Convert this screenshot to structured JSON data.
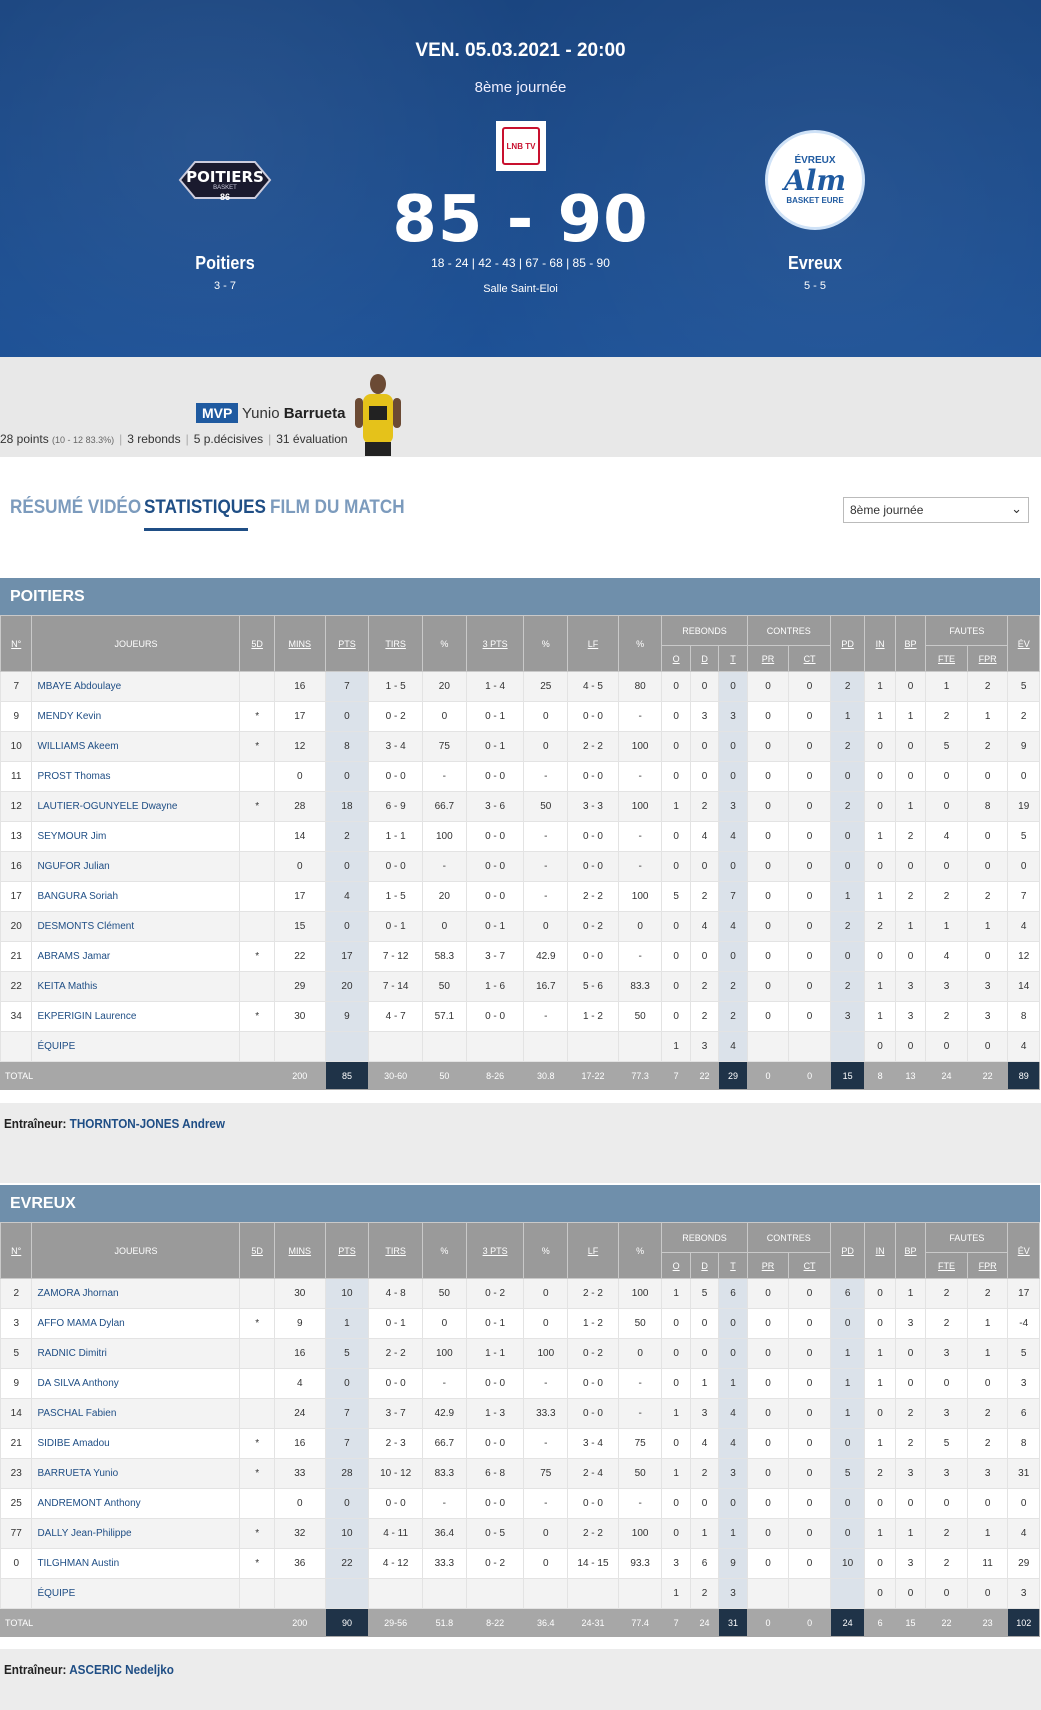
{
  "match": {
    "date": "VEN. 05.03.2021 - 20:00",
    "round": "8ème journée",
    "tv_logo": "LNB TV",
    "score": "85 - 90",
    "quarters": "18 - 24 | 42 - 43 | 67 - 68 | 85 - 90",
    "venue": "Salle Saint-Eloi",
    "home": {
      "name": "Poitiers",
      "record": "3 - 7",
      "logo_text": "POITIERS",
      "logo_sub": "BASKET",
      "logo_mark": "86"
    },
    "away": {
      "name": "Evreux",
      "record": "5 - 5",
      "logo_top": "ÉVREUX",
      "logo_mid": "Alm",
      "logo_bottom": "BASKET EURE"
    }
  },
  "mvp": {
    "tag": "MVP",
    "first": "Yunio",
    "last": "Barrueta",
    "points": "28 points",
    "points_detail": "(10 - 12 83.3%)",
    "rebounds": "3 rebonds",
    "assists": "5 p.décisives",
    "eval": "31 évaluation"
  },
  "tabs": [
    "RÉSUMÉ VIDÉO",
    "STATISTIQUES",
    "FILM DU MATCH"
  ],
  "select_value": "8ème journée",
  "headers": {
    "num": "N°",
    "player": "JOUEURS",
    "five": "5D",
    "mins": "MINS",
    "pts": "PTS",
    "tirs": "TIRS",
    "pct": "%",
    "three": "3 PTS",
    "lf": "LF",
    "rebounds": "REBONDS",
    "o": "O",
    "d": "D",
    "t": "T",
    "contres": "CONTRES",
    "pr": "PR",
    "ct": "CT",
    "pd": "PD",
    "in": "IN",
    "bp": "BP",
    "fautes": "FAUTES",
    "fte": "FTE",
    "fpr": "FPR",
    "ev": "ÉV"
  },
  "poitiers": {
    "title": "POITIERS",
    "rows": [
      [
        "7",
        "MBAYE Abdoulaye",
        "",
        "16",
        "7",
        "1 - 5",
        "20",
        "1 - 4",
        "25",
        "4 - 5",
        "80",
        "0",
        "0",
        "0",
        "0",
        "0",
        "2",
        "1",
        "0",
        "1",
        "2",
        "5"
      ],
      [
        "9",
        "MENDY Kevin",
        "*",
        "17",
        "0",
        "0 - 2",
        "0",
        "0 - 1",
        "0",
        "0 - 0",
        "-",
        "0",
        "3",
        "3",
        "0",
        "0",
        "1",
        "1",
        "1",
        "2",
        "1",
        "2"
      ],
      [
        "10",
        "WILLIAMS Akeem",
        "*",
        "12",
        "8",
        "3 - 4",
        "75",
        "0 - 1",
        "0",
        "2 - 2",
        "100",
        "0",
        "0",
        "0",
        "0",
        "0",
        "2",
        "0",
        "0",
        "5",
        "2",
        "9"
      ],
      [
        "11",
        "PROST Thomas",
        "",
        "0",
        "0",
        "0 - 0",
        "-",
        "0 - 0",
        "-",
        "0 - 0",
        "-",
        "0",
        "0",
        "0",
        "0",
        "0",
        "0",
        "0",
        "0",
        "0",
        "0",
        "0"
      ],
      [
        "12",
        "LAUTIER-OGUNYELE Dwayne",
        "*",
        "28",
        "18",
        "6 - 9",
        "66.7",
        "3 - 6",
        "50",
        "3 - 3",
        "100",
        "1",
        "2",
        "3",
        "0",
        "0",
        "2",
        "0",
        "1",
        "0",
        "8",
        "19"
      ],
      [
        "13",
        "SEYMOUR Jim",
        "",
        "14",
        "2",
        "1 - 1",
        "100",
        "0 - 0",
        "-",
        "0 - 0",
        "-",
        "0",
        "4",
        "4",
        "0",
        "0",
        "0",
        "1",
        "2",
        "4",
        "0",
        "5"
      ],
      [
        "16",
        "NGUFOR Julian",
        "",
        "0",
        "0",
        "0 - 0",
        "-",
        "0 - 0",
        "-",
        "0 - 0",
        "-",
        "0",
        "0",
        "0",
        "0",
        "0",
        "0",
        "0",
        "0",
        "0",
        "0",
        "0"
      ],
      [
        "17",
        "BANGURA Soriah",
        "",
        "17",
        "4",
        "1 - 5",
        "20",
        "0 - 0",
        "-",
        "2 - 2",
        "100",
        "5",
        "2",
        "7",
        "0",
        "0",
        "1",
        "1",
        "2",
        "2",
        "2",
        "7"
      ],
      [
        "20",
        "DESMONTS Clément",
        "",
        "15",
        "0",
        "0 - 1",
        "0",
        "0 - 1",
        "0",
        "0 - 2",
        "0",
        "0",
        "4",
        "4",
        "0",
        "0",
        "2",
        "2",
        "1",
        "1",
        "1",
        "4"
      ],
      [
        "21",
        "ABRAMS Jamar",
        "*",
        "22",
        "17",
        "7 - 12",
        "58.3",
        "3 - 7",
        "42.9",
        "0 - 0",
        "-",
        "0",
        "0",
        "0",
        "0",
        "0",
        "0",
        "0",
        "0",
        "4",
        "0",
        "12"
      ],
      [
        "22",
        "KEITA Mathis",
        "",
        "29",
        "20",
        "7 - 14",
        "50",
        "1 - 6",
        "16.7",
        "5 - 6",
        "83.3",
        "0",
        "2",
        "2",
        "0",
        "0",
        "2",
        "1",
        "3",
        "3",
        "3",
        "14"
      ],
      [
        "34",
        "EKPERIGIN Laurence",
        "*",
        "30",
        "9",
        "4 - 7",
        "57.1",
        "0 - 0",
        "-",
        "1 - 2",
        "50",
        "0",
        "2",
        "2",
        "0",
        "0",
        "3",
        "1",
        "3",
        "2",
        "3",
        "8"
      ],
      [
        "",
        "ÉQUIPE",
        "",
        "",
        "",
        "",
        "",
        "",
        "",
        "",
        "",
        "1",
        "3",
        "4",
        "",
        "",
        "",
        "0",
        "0",
        "0",
        "0",
        "4"
      ]
    ],
    "total": [
      "TOTAL",
      "200",
      "85",
      "30-60",
      "50",
      "8-26",
      "30.8",
      "17-22",
      "77.3",
      "7",
      "22",
      "29",
      "0",
      "0",
      "15",
      "8",
      "13",
      "24",
      "22",
      "89"
    ],
    "coach_label": "Entraîneur:",
    "coach": "THORNTON-JONES Andrew"
  },
  "evreux": {
    "title": "EVREUX",
    "rows": [
      [
        "2",
        "ZAMORA Jhornan",
        "",
        "30",
        "10",
        "4 - 8",
        "50",
        "0 - 2",
        "0",
        "2 - 2",
        "100",
        "1",
        "5",
        "6",
        "0",
        "0",
        "6",
        "0",
        "1",
        "2",
        "2",
        "17"
      ],
      [
        "3",
        "AFFO MAMA Dylan",
        "*",
        "9",
        "1",
        "0 - 1",
        "0",
        "0 - 1",
        "0",
        "1 - 2",
        "50",
        "0",
        "0",
        "0",
        "0",
        "0",
        "0",
        "0",
        "3",
        "2",
        "1",
        "-4"
      ],
      [
        "5",
        "RADNIC Dimitri",
        "",
        "16",
        "5",
        "2 - 2",
        "100",
        "1 - 1",
        "100",
        "0 - 2",
        "0",
        "0",
        "0",
        "0",
        "0",
        "0",
        "1",
        "1",
        "0",
        "3",
        "1",
        "5"
      ],
      [
        "9",
        "DA SILVA Anthony",
        "",
        "4",
        "0",
        "0 - 0",
        "-",
        "0 - 0",
        "-",
        "0 - 0",
        "-",
        "0",
        "1",
        "1",
        "0",
        "0",
        "1",
        "1",
        "0",
        "0",
        "0",
        "3"
      ],
      [
        "14",
        "PASCHAL Fabien",
        "",
        "24",
        "7",
        "3 - 7",
        "42.9",
        "1 - 3",
        "33.3",
        "0 - 0",
        "-",
        "1",
        "3",
        "4",
        "0",
        "0",
        "1",
        "0",
        "2",
        "3",
        "2",
        "6"
      ],
      [
        "21",
        "SIDIBE Amadou",
        "*",
        "16",
        "7",
        "2 - 3",
        "66.7",
        "0 - 0",
        "-",
        "3 - 4",
        "75",
        "0",
        "4",
        "4",
        "0",
        "0",
        "0",
        "1",
        "2",
        "5",
        "2",
        "8"
      ],
      [
        "23",
        "BARRUETA Yunio",
        "*",
        "33",
        "28",
        "10 - 12",
        "83.3",
        "6 - 8",
        "75",
        "2 - 4",
        "50",
        "1",
        "2",
        "3",
        "0",
        "0",
        "5",
        "2",
        "3",
        "3",
        "3",
        "31"
      ],
      [
        "25",
        "ANDREMONT Anthony",
        "",
        "0",
        "0",
        "0 - 0",
        "-",
        "0 - 0",
        "-",
        "0 - 0",
        "-",
        "0",
        "0",
        "0",
        "0",
        "0",
        "0",
        "0",
        "0",
        "0",
        "0",
        "0"
      ],
      [
        "77",
        "DALLY Jean-Philippe",
        "*",
        "32",
        "10",
        "4 - 11",
        "36.4",
        "0 - 5",
        "0",
        "2 - 2",
        "100",
        "0",
        "1",
        "1",
        "0",
        "0",
        "0",
        "1",
        "1",
        "2",
        "1",
        "4"
      ],
      [
        "0",
        "TILGHMAN Austin",
        "*",
        "36",
        "22",
        "4 - 12",
        "33.3",
        "0 - 2",
        "0",
        "14 - 15",
        "93.3",
        "3",
        "6",
        "9",
        "0",
        "0",
        "10",
        "0",
        "3",
        "2",
        "11",
        "29"
      ],
      [
        "",
        "ÉQUIPE",
        "",
        "",
        "",
        "",
        "",
        "",
        "",
        "",
        "",
        "1",
        "2",
        "3",
        "",
        "",
        "",
        "0",
        "0",
        "0",
        "0",
        "3"
      ]
    ],
    "total": [
      "TOTAL",
      "200",
      "90",
      "29-56",
      "51.8",
      "8-22",
      "36.4",
      "24-31",
      "77.4",
      "7",
      "24",
      "31",
      "0",
      "0",
      "24",
      "6",
      "15",
      "22",
      "23",
      "102"
    ],
    "coach_label": "Entraîneur:",
    "coach": "ASCERIC Nedeljko"
  }
}
